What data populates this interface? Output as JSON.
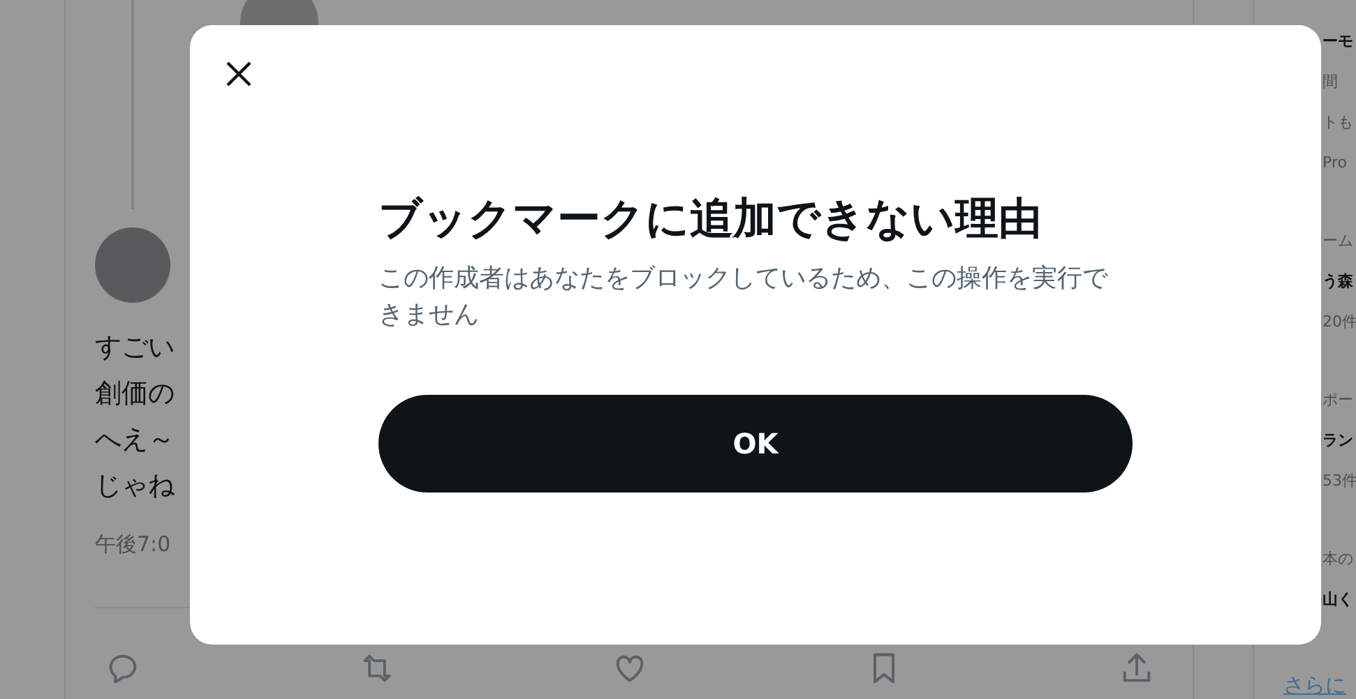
{
  "timeline": {
    "reply": {
      "text_lines": [
        "すごい",
        "創価の",
        "へえ～",
        "じゃね"
      ],
      "time": "午後7:0"
    }
  },
  "sidebar": {
    "sections": [
      {
        "lines": [
          {
            "text": "ーモ",
            "kind": "title"
          },
          {
            "text": "間",
            "kind": "body"
          },
          {
            "text": "トも",
            "kind": "body"
          },
          {
            "text": "Pro",
            "kind": "meta"
          }
        ]
      },
      {
        "lines": [
          {
            "text": "ーム",
            "kind": "meta"
          },
          {
            "text": "う森",
            "kind": "title"
          },
          {
            "text": "20件",
            "kind": "meta"
          }
        ]
      },
      {
        "lines": [
          {
            "text": "ポー",
            "kind": "meta"
          },
          {
            "text": "ラン",
            "kind": "title"
          },
          {
            "text": "53件",
            "kind": "meta"
          }
        ]
      },
      {
        "lines": [
          {
            "text": "本の",
            "kind": "meta"
          },
          {
            "text": "山く",
            "kind": "title"
          }
        ]
      }
    ],
    "more_link": "さらに"
  },
  "dialog": {
    "title": "ブックマークに追加できない理由",
    "message": "この作成者はあなたをブロックしているため、この操作を実行できません",
    "button": "OK"
  }
}
